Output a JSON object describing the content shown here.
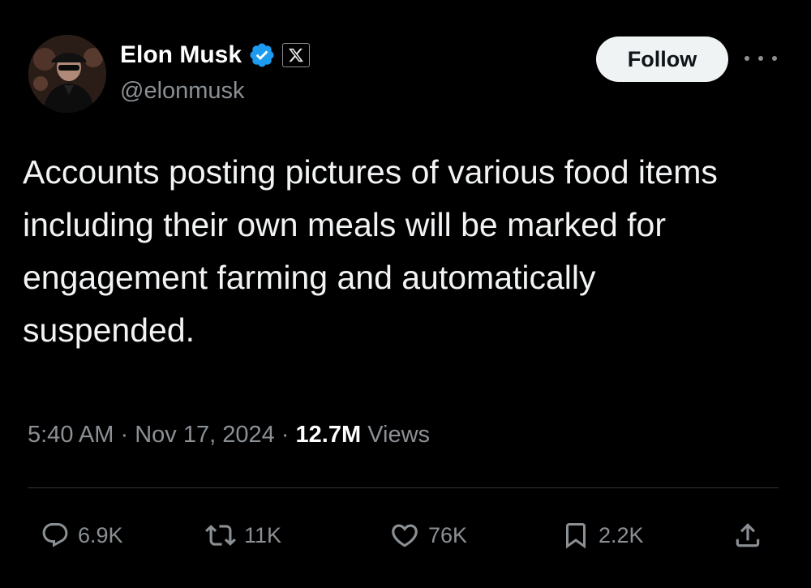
{
  "author": {
    "name": "Elon Musk",
    "handle": "@elonmusk",
    "affiliation_badge": "X"
  },
  "follow_label": "Follow",
  "tweet": {
    "text": "Accounts posting pictures of various food items\nincluding their own meals will be marked for\nengagement farming and automatically\nsuspended."
  },
  "meta": {
    "time": "5:40 AM",
    "separator": "·",
    "date": "Nov 17, 2024",
    "views_count": "12.7M",
    "views_label": "Views"
  },
  "actions": {
    "replies": "6.9K",
    "reposts": "11K",
    "likes": "76K",
    "bookmarks": "2.2K"
  },
  "colors": {
    "background": "#000000",
    "verified": "#1d9bf0",
    "muted_text": "#8b9095",
    "follow_button_bg": "#eff3f4"
  },
  "icons": {
    "verified": "verified-badge-icon",
    "affiliation": "x-logo-icon",
    "more": "more-icon",
    "reply": "reply-icon",
    "repost": "repost-icon",
    "like": "heart-icon",
    "bookmark": "bookmark-icon",
    "share": "share-icon"
  }
}
